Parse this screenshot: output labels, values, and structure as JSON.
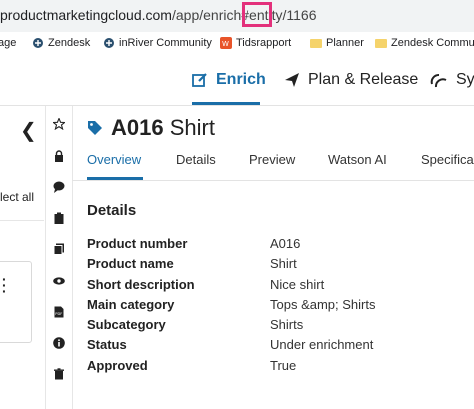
{
  "browser": {
    "url_host": "productmarketingcloud.com",
    "url_path": "/app/enrich#entity/",
    "url_entity_id": "1166"
  },
  "bookmarks": [
    {
      "label": "age",
      "icon": "bookmark-icon"
    },
    {
      "label": "Zendesk",
      "icon": "zendesk-icon"
    },
    {
      "label": "inRiver Community",
      "icon": "inriver-icon"
    },
    {
      "label": "Tidsrapport",
      "icon": "tidsrapport-icon"
    },
    {
      "label": "Planner",
      "icon": "folder-icon"
    },
    {
      "label": "Zendesk Community",
      "icon": "folder-icon"
    }
  ],
  "app_nav": {
    "tabs": [
      {
        "label": "Enrich",
        "icon": "edit-icon",
        "active": true
      },
      {
        "label": "Plan & Release",
        "icon": "send-icon",
        "active": false
      },
      {
        "label": "Sy",
        "icon": "sync-icon",
        "active": false
      }
    ]
  },
  "left_panel": {
    "back_icon": "chevron-left-icon",
    "select_all_label": "lect all"
  },
  "icon_column": [
    "star-icon",
    "lock-icon",
    "comment-icon",
    "clipboard-icon",
    "copy-icon",
    "eye-icon",
    "pdf-icon",
    "info-icon",
    "trash-icon"
  ],
  "entity": {
    "icon": "tag-icon",
    "number": "A016",
    "name": "Shirt"
  },
  "entity_tabs": [
    "Overview",
    "Details",
    "Preview",
    "Watson AI",
    "Specifica"
  ],
  "details": {
    "section_title": "Details",
    "fields": [
      {
        "label": "Product number",
        "value": "A016"
      },
      {
        "label": "Product name",
        "value": "Shirt"
      },
      {
        "label": "Short description",
        "value": "Nice shirt"
      },
      {
        "label": "Main category",
        "value": "Tops &amp; Shirts"
      },
      {
        "label": "Subcategory",
        "value": "Shirts"
      },
      {
        "label": "Status",
        "value": "Under enrichment"
      },
      {
        "label": "Approved",
        "value": "True"
      }
    ]
  },
  "colors": {
    "accent": "#1a6ea8",
    "highlight_box": "#e3307b"
  }
}
